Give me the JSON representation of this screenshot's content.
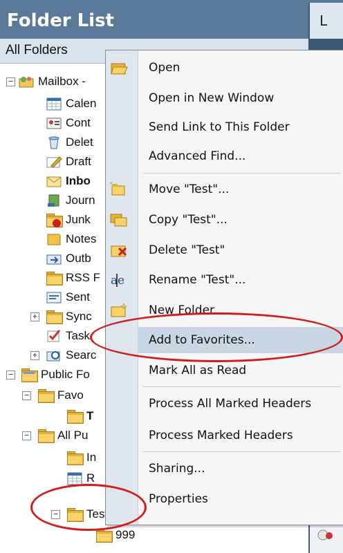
{
  "header": {
    "title": "Folder List",
    "subheader": "All Folders",
    "right_char": "L"
  },
  "tree": {
    "mailbox": "Mailbox -",
    "calendar": "Calen",
    "contacts": "Cont",
    "deleted": "Delet",
    "drafts": "Draft",
    "inbox": "Inbo",
    "journal": "Journ",
    "junk": "Junk",
    "notes": "Notes",
    "outbox": "Outb",
    "rss": "RSS F",
    "sent": "Sent",
    "sync": "Sync",
    "tasks": "Task",
    "search": "Searc",
    "public": "Public Fo",
    "favorites": "Favo",
    "test_fav": "T",
    "all_public": "All Pu",
    "in": "In",
    "r": "R",
    "test": "Test",
    "n999": "999"
  },
  "menu": {
    "open": "Open",
    "open_new_window": "Open in New Window",
    "send_link": "Send Link to This Folder",
    "advanced_find": "Advanced Find...",
    "move": "Move \"Test\"...",
    "copy": "Copy \"Test\"...",
    "delete": "Delete \"Test\"",
    "rename": "Rename \"Test\"...",
    "new_folder": "New Folder...",
    "add_favorites": "Add to Favorites...",
    "mark_all_read": "Mark All as Read",
    "process_all": "Process All Marked Headers",
    "process_marked": "Process Marked Headers",
    "sharing": "Sharing...",
    "properties": "Properties"
  },
  "icons": {
    "open": "open-folder-icon",
    "move": "move-folder-icon",
    "copy": "copy-folder-icon",
    "delete": "delete-folder-icon",
    "rename": "rename-icon",
    "new_folder": "new-folder-icon"
  },
  "colors": {
    "header_bg": "#5b7a99",
    "highlight": "#c9d6e4",
    "annotation": "#d21c1c"
  }
}
